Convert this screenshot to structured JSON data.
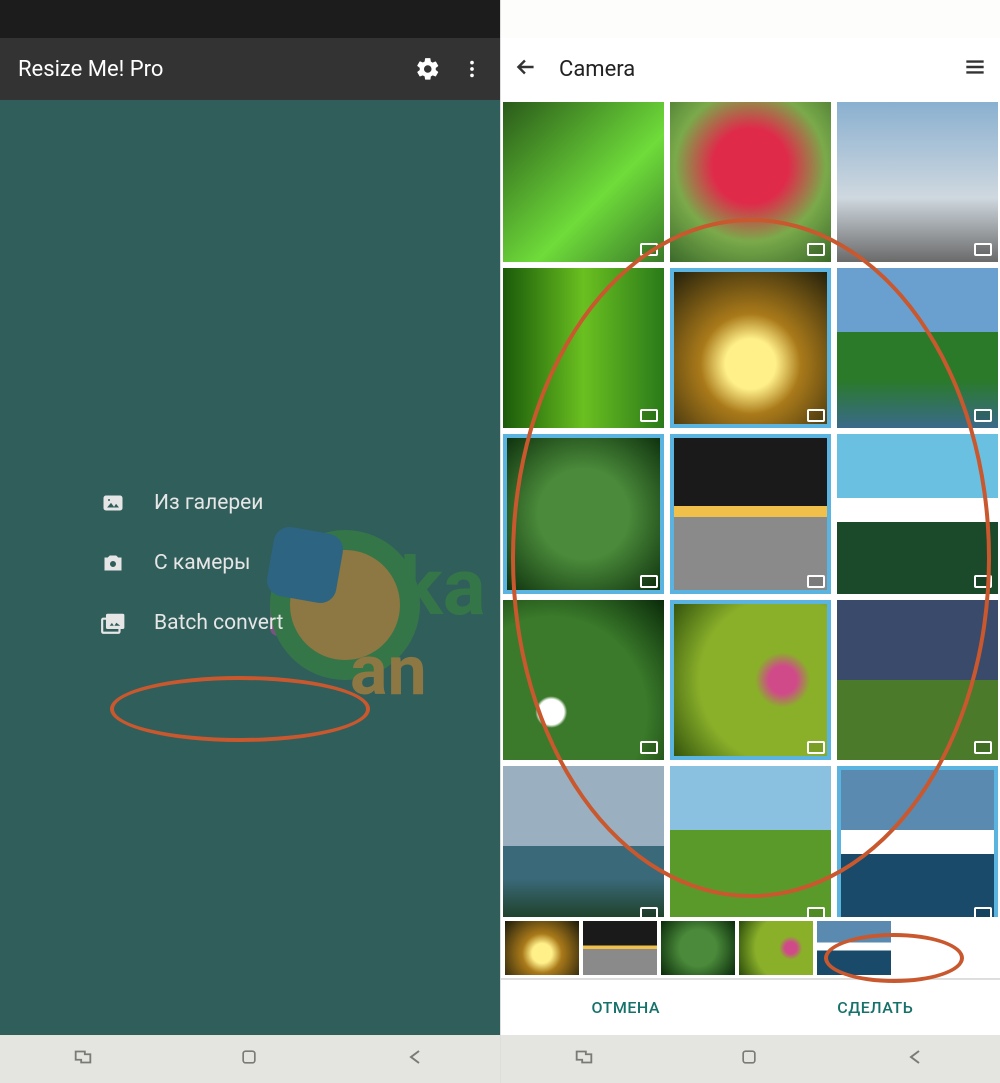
{
  "left": {
    "app_title": "Resize Me! Pro",
    "menu": [
      {
        "label": "Из галереи",
        "icon": "image-icon"
      },
      {
        "label": "С камеры",
        "icon": "camera-icon"
      },
      {
        "label": "Batch convert",
        "icon": "images-stack-icon"
      }
    ]
  },
  "right": {
    "title": "Camera",
    "actions": {
      "cancel_label": "ОТМЕНА",
      "done_label": "СДЕЛАТЬ"
    },
    "grid_selected_indices": [
      4,
      6,
      7,
      10,
      14
    ],
    "selection_strip_count": 5
  }
}
